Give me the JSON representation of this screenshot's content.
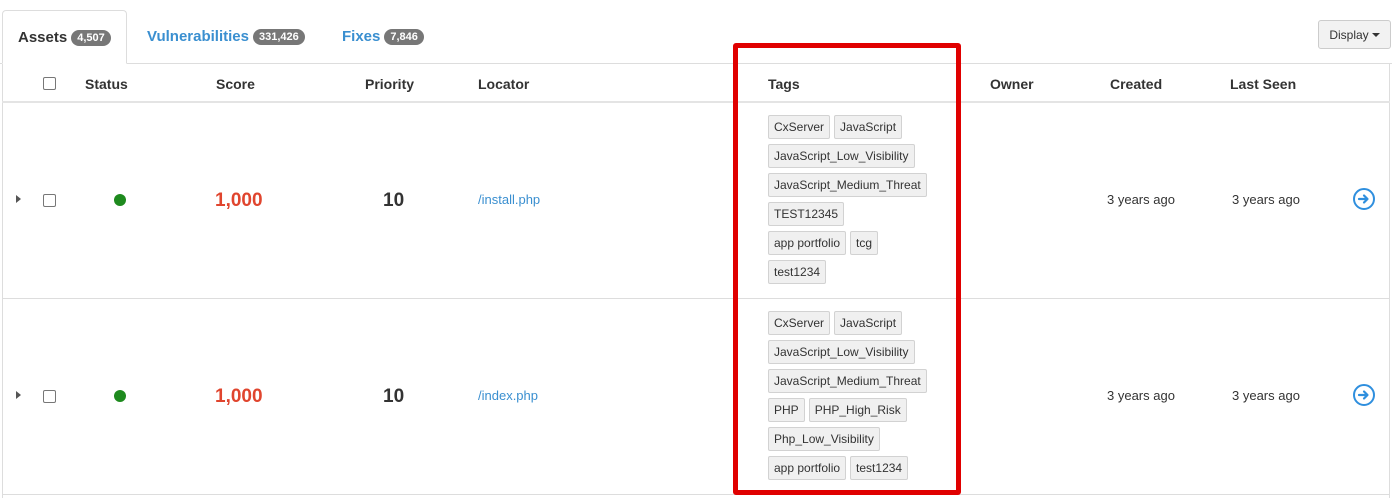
{
  "tabs": [
    {
      "label": "Assets",
      "count": "4,507",
      "active": true
    },
    {
      "label": "Vulnerabilities",
      "count": "331,426",
      "active": false
    },
    {
      "label": "Fixes",
      "count": "7,846",
      "active": false
    }
  ],
  "display_button": "Display",
  "columns": {
    "status": "Status",
    "score": "Score",
    "priority": "Priority",
    "locator": "Locator",
    "tags": "Tags",
    "owner": "Owner",
    "created": "Created",
    "last_seen": "Last Seen"
  },
  "rows": [
    {
      "status": "active",
      "score": "1,000",
      "priority": "10",
      "locator": "/install.php",
      "owner": "",
      "created": "3 years ago",
      "last_seen": "3 years ago",
      "tags": [
        "CxServer",
        "JavaScript",
        "JavaScript_Low_Visibility",
        "JavaScript_Medium_Threat",
        "TEST12345",
        "app portfolio",
        "tcg",
        "test1234"
      ]
    },
    {
      "status": "active",
      "score": "1,000",
      "priority": "10",
      "locator": "/index.php",
      "owner": "",
      "created": "3 years ago",
      "last_seen": "3 years ago",
      "tags": [
        "CxServer",
        "JavaScript",
        "JavaScript_Low_Visibility",
        "JavaScript_Medium_Threat",
        "PHP",
        "PHP_High_Risk",
        "Php_Low_Visibility",
        "app portfolio",
        "test1234"
      ]
    }
  ],
  "colors": {
    "status_ok": "#1e8a1e",
    "score": "#e0452e",
    "link": "#3a8fd0",
    "highlight": "#e00000"
  }
}
